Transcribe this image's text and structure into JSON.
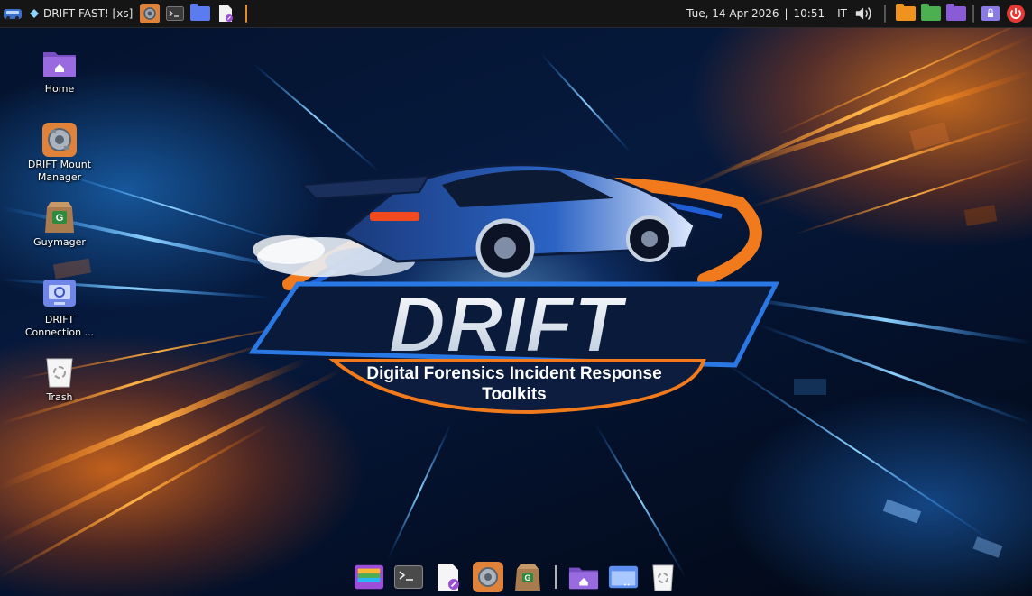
{
  "top_panel": {
    "app_title": "DRIFT FAST! [xs]",
    "date": "Tue, 14 Apr 2026",
    "separator": "|",
    "time": "10:51",
    "keyboard_layout": "IT",
    "colors": {
      "panel_bg": "#151515",
      "accent_separator": "#e58a2b",
      "power": "#e53935"
    }
  },
  "desktop_icons": [
    {
      "label": "Home",
      "icon": "home-folder-icon"
    },
    {
      "label": "DRIFT Mount Manager",
      "icon": "gear-engine-icon"
    },
    {
      "label": "Guymager",
      "icon": "guymager-box-icon"
    },
    {
      "label": "DRIFT Connection ...",
      "icon": "remote-connection-icon"
    },
    {
      "label": "Trash",
      "icon": "trash-icon"
    }
  ],
  "logo": {
    "title": "DRIFT",
    "subtitle_line1": "Digital Forensics Incident Response",
    "subtitle_line2": "Toolkits"
  },
  "dock": {
    "items": [
      "file-manager-icon",
      "terminal-icon",
      "text-editor-icon",
      "drift-mount-manager-icon",
      "guymager-icon",
      "home-folder-icon",
      "window-icon",
      "trash-icon"
    ]
  }
}
